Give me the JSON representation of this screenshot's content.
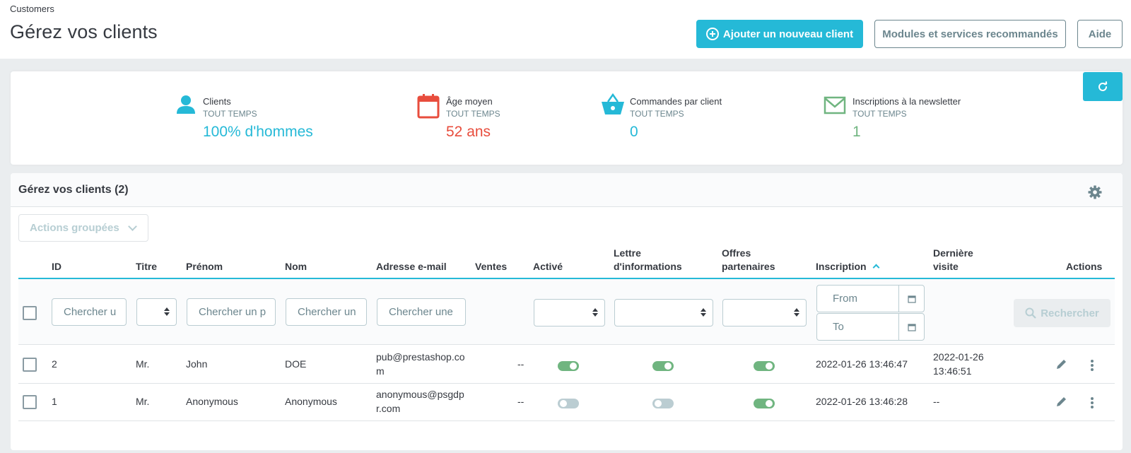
{
  "header": {
    "breadcrumb": "Customers",
    "title": "Gérez vos clients",
    "add_button": "Ajouter un nouveau client",
    "modules_button": "Modules et services recommandés",
    "help_button": "Aide"
  },
  "kpis": [
    {
      "title": "Clients",
      "period": "TOUT TEMPS",
      "value": "100% d'hommes",
      "color": "#25b9d7",
      "icon": "user-icon"
    },
    {
      "title": "Âge moyen",
      "period": "TOUT TEMPS",
      "value": "52 ans",
      "color": "#e84d3d",
      "icon": "calendar-icon"
    },
    {
      "title": "Commandes par client",
      "period": "TOUT TEMPS",
      "value": "0",
      "color": "#25b9d7",
      "icon": "basket-icon"
    },
    {
      "title": "Inscriptions à la newsletter",
      "period": "TOUT TEMPS",
      "value": "1",
      "color": "#70b580",
      "icon": "envelope-icon"
    }
  ],
  "grid": {
    "title": "Gérez vos clients (2)",
    "bulk_actions": "Actions groupées",
    "columns": {
      "id": "ID",
      "title": "Titre",
      "firstname": "Prénom",
      "lastname": "Nom",
      "email": "Adresse e-mail",
      "sales": "Ventes",
      "active": "Activé",
      "newsletter_1": "Lettre",
      "newsletter_2": "d'informations",
      "optin_1": "Offres",
      "optin_2": "partenaires",
      "date_add": "Inscription",
      "last_visit_1": "Dernière",
      "last_visit_2": "visite",
      "actions": "Actions"
    },
    "filters": {
      "id_placeholder": "Chercher u",
      "firstname_placeholder": "Chercher un p",
      "lastname_placeholder": "Chercher un",
      "email_placeholder": "Chercher une",
      "date_from": "From",
      "date_to": "To",
      "search_button": "Rechercher"
    },
    "rows": [
      {
        "id": "2",
        "title": "Mr.",
        "firstname": "John",
        "lastname": "DOE",
        "email_1": "pub@prestashop.co",
        "email_2": "m",
        "sales": "--",
        "active": true,
        "newsletter": true,
        "optin": true,
        "date_add": "2022-01-26 13:46:47",
        "last_visit_1": "2022-01-26",
        "last_visit_2": "13:46:51"
      },
      {
        "id": "1",
        "title": "Mr.",
        "firstname": "Anonymous",
        "lastname": "Anonymous",
        "email_1": "anonymous@psgdp",
        "email_2": "r.com",
        "sales": "--",
        "active": false,
        "newsletter": false,
        "optin": true,
        "date_add": "2022-01-26 13:46:28",
        "last_visit_1": "--",
        "last_visit_2": ""
      }
    ]
  },
  "colors": {
    "primary": "#25b9d7",
    "danger": "#e84d3d",
    "success": "#70b580",
    "muted": "#6c868e"
  }
}
